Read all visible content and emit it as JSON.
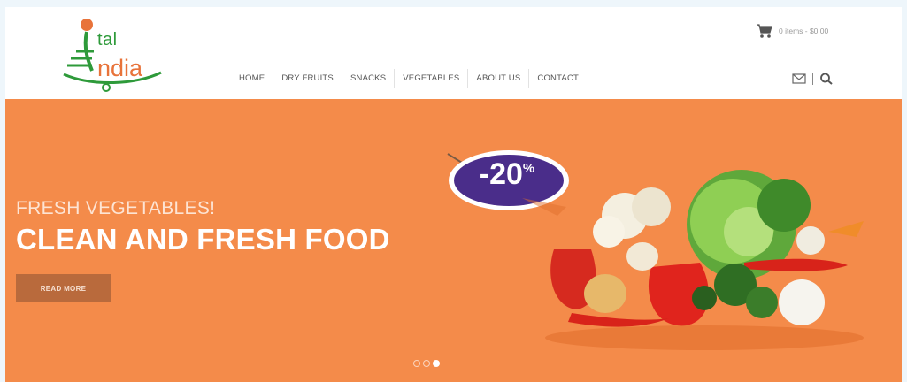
{
  "logo": {
    "line1": "tal",
    "line2": "ndia"
  },
  "nav": {
    "items": [
      {
        "label": "HOME"
      },
      {
        "label": "DRY FRUITS"
      },
      {
        "label": "SNACKS"
      },
      {
        "label": "VEGETABLES"
      },
      {
        "label": "ABOUT US"
      },
      {
        "label": "CONTACT"
      }
    ]
  },
  "cart": {
    "summary": "0 items - $0.00",
    "icon": "cart-icon"
  },
  "header_icons": {
    "mail": "mail-icon",
    "search": "search-icon"
  },
  "hero": {
    "subtitle": "FRESH VEGETABLES!",
    "title": "CLEAN AND FRESH FOOD",
    "button_label": "READ MORE",
    "badge_value": "-20",
    "badge_unit": "%",
    "slides_total": 3,
    "active_slide": 3
  },
  "colors": {
    "hero_bg": "#f48b4a",
    "button_bg": "#b96a3c",
    "badge_bg": "#4a2d8a",
    "logo_green": "#2e9a3a",
    "logo_orange": "#e8733a"
  }
}
